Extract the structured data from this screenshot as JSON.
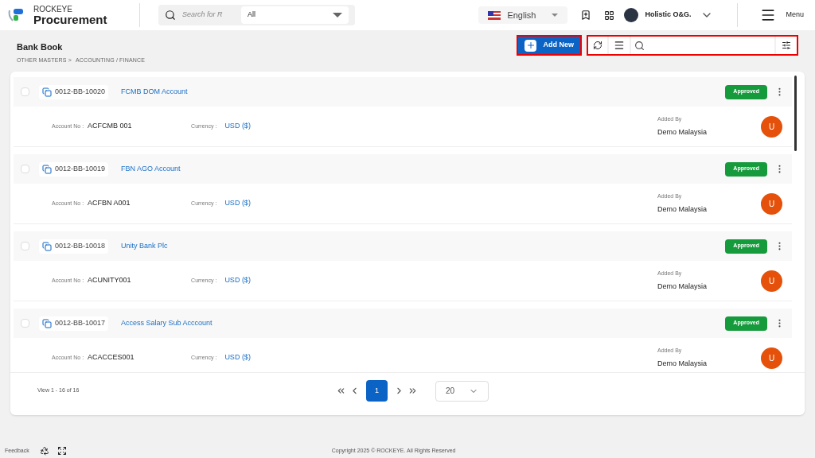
{
  "header": {
    "brand_top": "ROCKEYE",
    "brand_name": "Procurement",
    "search": {
      "placeholder": "Search for R"
    },
    "scope": "All",
    "language": "English",
    "user": "Holistic O&G.",
    "menu": "Menu"
  },
  "page": {
    "title": "Bank Book",
    "breadcrumb": [
      "OTHER MASTERS >",
      "ACCOUNTING / FINANCE"
    ],
    "add_button": "Add New"
  },
  "records": [
    {
      "code": "0012-BB-10020",
      "name": "FCMB DOM Account",
      "status": "Approved",
      "checked": false,
      "account_label": "Account No :",
      "account": "ACFCMB 001",
      "currency_label": "Currency :",
      "currency": "USD ($)",
      "added_by_label": "Added By",
      "added_by": "Demo Malaysia",
      "avatar": "U"
    },
    {
      "code": "0012-BB-10019",
      "name": "FBN AGO Account",
      "status": "Approved",
      "checked": false,
      "account_label": "Account No :",
      "account": "ACFBN A001",
      "currency_label": "Currency :",
      "currency": "USD ($)",
      "added_by_label": "Added By",
      "added_by": "Demo Malaysia",
      "avatar": "U"
    },
    {
      "code": "0012-BB-10018",
      "name": "Unity Bank Plc",
      "status": "Approved",
      "checked": false,
      "account_label": "Account No :",
      "account": "ACUNITY001",
      "currency_label": "Currency :",
      "currency": "USD ($)",
      "added_by_label": "Added By",
      "added_by": "Demo Malaysia",
      "avatar": "U"
    },
    {
      "code": "0012-BB-10017",
      "name": "Access Salary Sub Acccount",
      "status": "Approved",
      "checked": false,
      "account_label": "Account No :",
      "account": "ACACCES001",
      "currency_label": "Currency :",
      "currency": "USD ($)",
      "added_by_label": "Added By",
      "added_by": "Demo Malaysia",
      "avatar": "U"
    }
  ],
  "pagination": {
    "summary": "View 1 - 16 of 16",
    "pages": [
      {
        "label": "1",
        "selected": true
      }
    ],
    "page_size": "20"
  },
  "footer": {
    "feedback": "Feedback",
    "copyright": "Copyright 2025 © ROCKEYE. All Rights Reserved"
  }
}
